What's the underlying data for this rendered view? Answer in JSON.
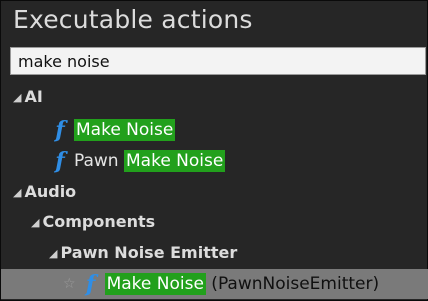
{
  "panel": {
    "title": "Executable actions"
  },
  "search": {
    "value": "make noise"
  },
  "tree": {
    "ai": {
      "label": "AI",
      "items": [
        {
          "prefix": "",
          "match": "Make Noise",
          "suffix": ""
        },
        {
          "prefix": "Pawn ",
          "match": "Make Noise",
          "suffix": ""
        }
      ]
    },
    "audio": {
      "label": "Audio",
      "components": {
        "label": "Components",
        "pawn_noise_emitter": {
          "label": "Pawn Noise Emitter",
          "items": [
            {
              "prefix": "",
              "match": "Make Noise",
              "suffix": " (PawnNoiseEmitter)"
            }
          ]
        }
      }
    }
  },
  "icons": {
    "expanded": "expanded-arrow-icon",
    "function": "function-icon",
    "favorite": "star-icon"
  },
  "colors": {
    "panel_bg": "#262626",
    "highlight": "#22a01c",
    "function_icon": "#2f8ee6",
    "selected_row": "#7a7a7a"
  }
}
